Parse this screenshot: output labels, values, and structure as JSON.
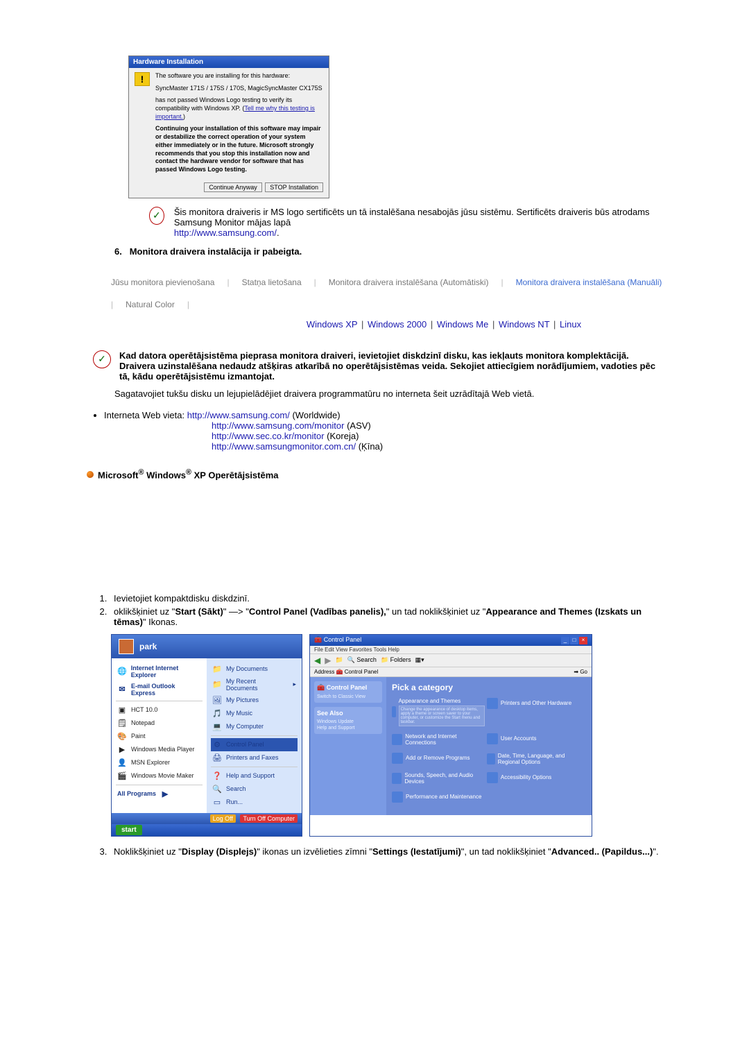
{
  "hw_dialog": {
    "title": "Hardware Installation",
    "line1": "The software you are installing for this hardware:",
    "device": "SyncMaster 171S / 175S / 170S, MagicSyncMaster CX175S",
    "logo1": "has not passed Windows Logo testing to verify its compatibility with Windows XP. (",
    "logo_link": "Tell me why this testing is important.",
    "logo2": ")",
    "warn": "Continuing your installation of this software may impair or destabilize the correct operation of your system either immediately or in the future. Microsoft strongly recommends that you stop this installation now and contact the hardware vendor for software that has passed Windows Logo testing.",
    "btn_continue": "Continue Anyway",
    "btn_stop": "STOP Installation"
  },
  "cert_text": "Šis monitora draiveris ir MS logo sertificēts un tā instalēšana nesabojās jūsu sistēmu. Sertificēts draiveris būs atrodams Samsung Monitor mājas lapā",
  "cert_url_label": "http://www.samsung.com/",
  "step6_num": "6.",
  "step6_text": "Monitora draivera instalācija ir pabeigta.",
  "tabs": {
    "t1": "Jūsu monitora pievienošana",
    "t2": "Statņa lietošana",
    "t3": "Monitora draivera instalēšana (Automātiski)",
    "t4": "Monitora draivera instalēšana (Manuāli)",
    "t5": "Natural Color"
  },
  "os": {
    "xp": "Windows XP",
    "w2000": "Windows 2000",
    "me": "Windows Me",
    "nt": "Windows NT",
    "linux": "Linux"
  },
  "disk_bold": "Kad datora operētājsistēma pieprasa monitora draiveri, ievietojiet diskdzinī disku, kas iekļauts monitora komplektācijā. Draivera uzinstalēšana nedaudz atšķiras atkarībā no operētājsistēmas veida. Sekojiet attiecīgiem norādījumiem, vadoties pēc tā, kādu operētājsistēmu izmantojat.",
  "disk_plain": "Sagatavojiet tukšu disku un lejupielādējiet draivera programmatūru no interneta šeit uzrādītajā Web vietā.",
  "web_label": "Interneta Web vieta:",
  "urls": {
    "u1": "http://www.samsung.com/",
    "u1_suffix": " (Worldwide)",
    "u2": "http://www.samsung.com/monitor",
    "u2_suffix": " (ASV)",
    "u3": "http://www.sec.co.kr/monitor",
    "u3_suffix": " (Koreja)",
    "u4": "http://www.samsungmonitor.com.cn/",
    "u4_suffix": " (Ķīna)"
  },
  "xp_heading_a": "Microsoft",
  "xp_heading_b": " Windows",
  "xp_heading_c": " XP Operētājsistēma",
  "steps": {
    "s1": "Ievietojiet kompaktdisku diskdzinī.",
    "s2a": "oklikšķiniet uz \"",
    "s2b": "Start (Sākt)",
    "s2c": "\" —> \"",
    "s2d": "Control Panel (Vadības panelis),",
    "s2e": "\" un tad noklikšķiniet uz \"",
    "s2f": "Appearance and Themes (Izskats un tēmas)",
    "s2g": "\" Ikonas.",
    "s3a": "Noklikšķiniet uz \"",
    "s3b": "Display (Displejs)",
    "s3c": "\" ikonas un izvēlieties zīmni \"",
    "s3d": "Settings (Iestatījumi)",
    "s3e": "\", un tad noklikšķiniet \"",
    "s3f": "Advanced.. (Papildus...)",
    "s3g": "\"."
  },
  "start_menu": {
    "user": "park",
    "left": [
      "Internet\nInternet Explorer",
      "E-mail\nOutlook Express",
      "HCT 10.0",
      "Notepad",
      "Paint",
      "Windows Media Player",
      "MSN Explorer",
      "Windows Movie Maker"
    ],
    "left_all": "All Programs",
    "right": [
      "My Documents",
      "My Recent Documents",
      "My Pictures",
      "My Music",
      "My Computer",
      "Control Panel",
      "Printers and Faxes",
      "Help and Support",
      "Search",
      "Run..."
    ],
    "logoff": "Log Off",
    "turnoff": "Turn Off Computer",
    "start": "start"
  },
  "control_panel": {
    "title": "Control Panel",
    "menu": "File   Edit   View   Favorites   Tools   Help",
    "toolbar_search": "Search",
    "toolbar_folders": "Folders",
    "addr_label": "Address",
    "addr_val": "Control Panel",
    "addr_go": "Go",
    "side1_title": "Control Panel",
    "side1_item": "Switch to Classic View",
    "side2_title": "See Also",
    "side2_a": "Windows Update",
    "side2_b": "Help and Support",
    "heading": "Pick a category",
    "cats": [
      "Appearance and Themes",
      "Printers and Other Hardware",
      "Network and Internet Connections",
      "User Accounts",
      "Add or Remove Programs",
      "Date, Time, Language, and Regional Options",
      "Sounds, Speech, and Audio Devices",
      "Accessibility Options",
      "Performance and Maintenance"
    ],
    "sub_hint": "Change the appearance of desktop items, apply a theme or screen saver to your computer, or customize the Start menu and taskbar."
  }
}
